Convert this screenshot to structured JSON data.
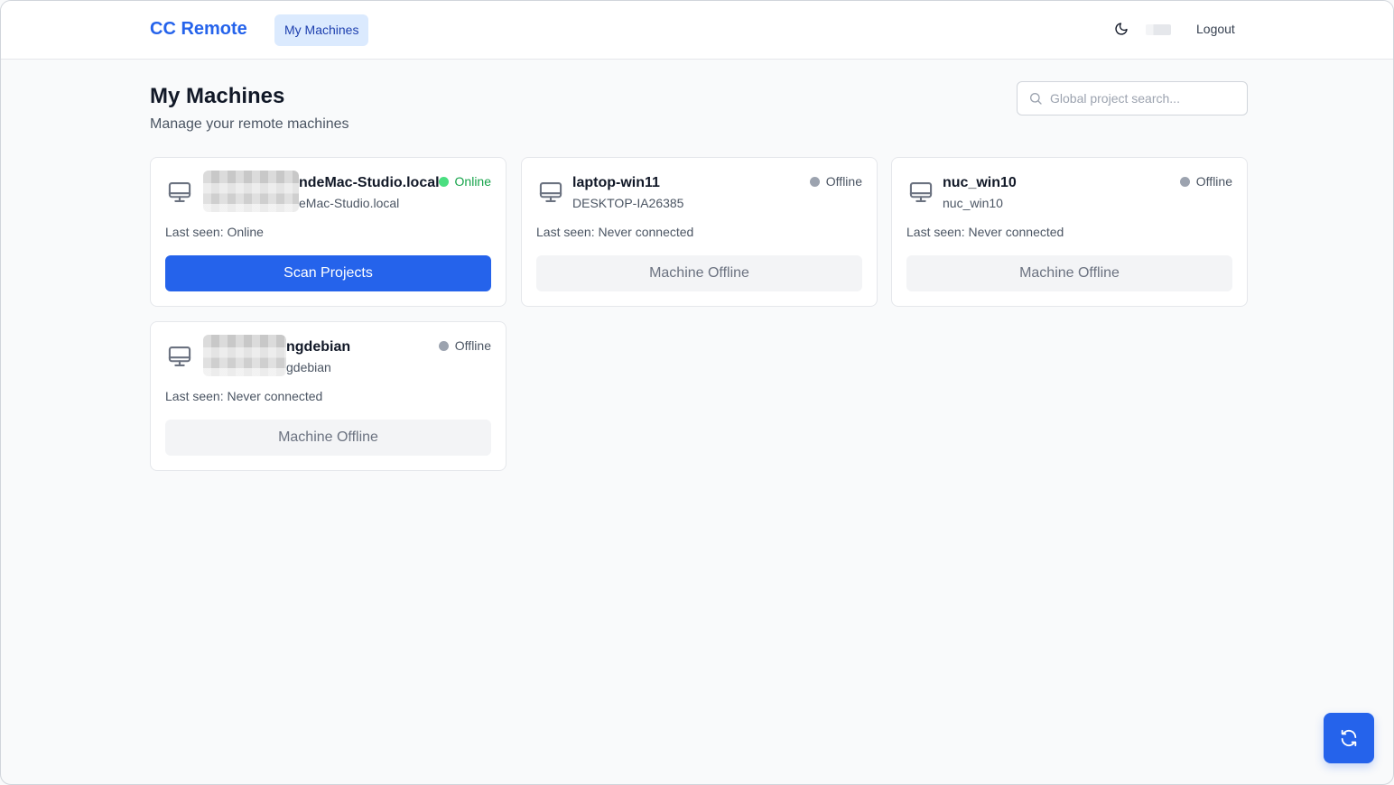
{
  "header": {
    "brand": "CC Remote",
    "nav_machines": "My Machines",
    "logout": "Logout"
  },
  "page": {
    "title": "My Machines",
    "subtitle": "Manage your remote machines"
  },
  "search": {
    "placeholder": "Global project search..."
  },
  "machines": [
    {
      "name": "ndeMac-Studio.local",
      "host": "eMac-Studio.local",
      "status": "Online",
      "last_seen": "Last seen: Online",
      "action": "Scan Projects"
    },
    {
      "name": "laptop-win11",
      "host": "DESKTOP-IA26385",
      "status": "Offline",
      "last_seen": "Last seen: Never connected",
      "action": "Machine Offline"
    },
    {
      "name": "nuc_win10",
      "host": "nuc_win10",
      "status": "Offline",
      "last_seen": "Last seen: Never connected",
      "action": "Machine Offline"
    },
    {
      "name": "ngdebian",
      "host": "gdebian",
      "status": "Offline",
      "last_seen": "Last seen: Never connected",
      "action": "Machine Offline"
    }
  ],
  "colors": {
    "accent": "#2563eb",
    "online": "#22c55e",
    "offline": "#9ca3af"
  },
  "icons": {
    "theme": "moon-icon",
    "search": "search-icon",
    "machine": "monitor-icon",
    "refresh": "refresh-icon"
  }
}
